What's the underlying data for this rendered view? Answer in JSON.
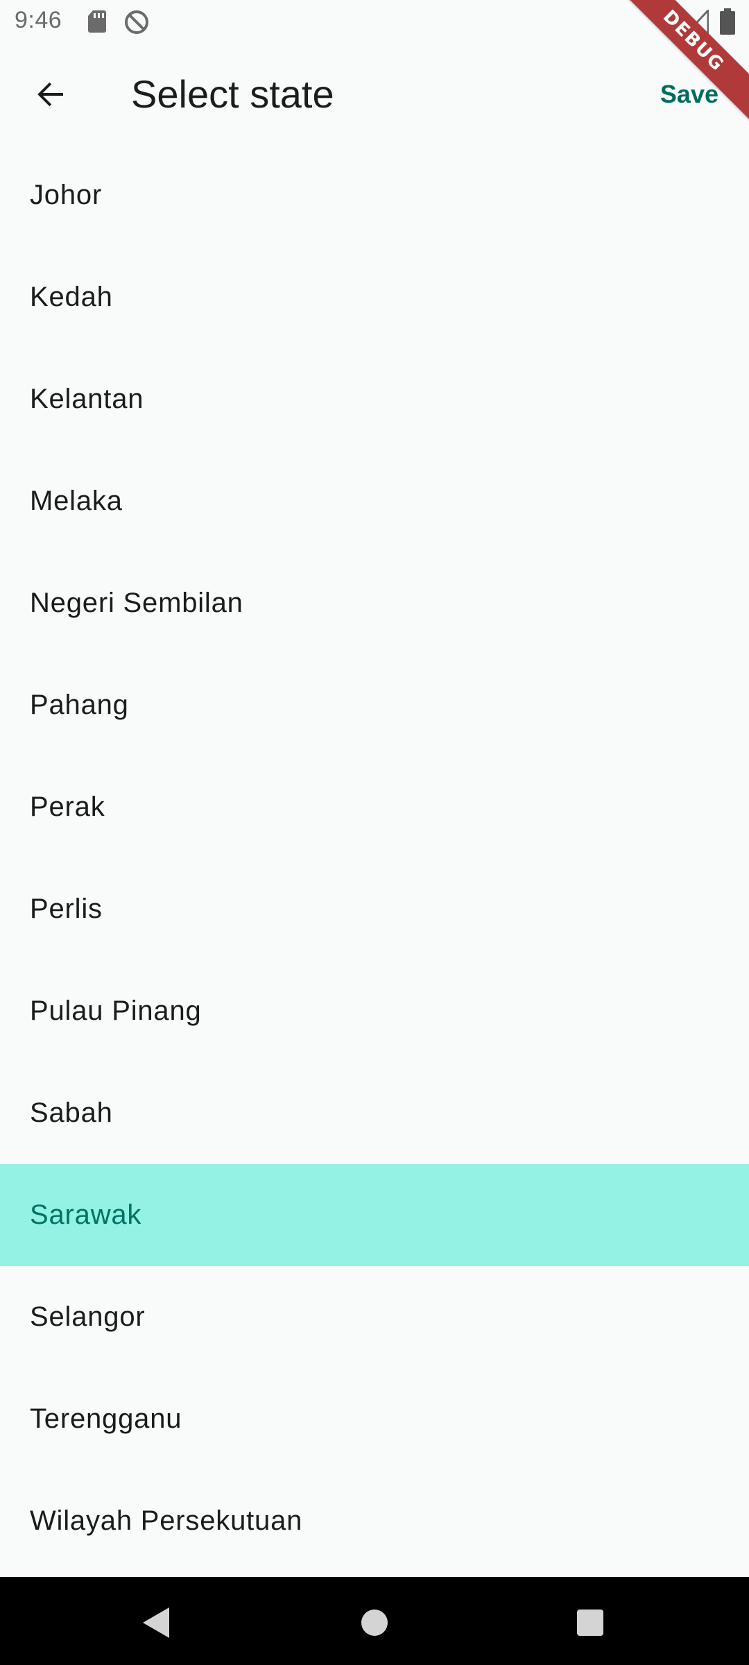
{
  "status_bar": {
    "time": "9:46",
    "icons": [
      "sd-card-icon",
      "do-not-disturb-icon",
      "wifi-icon",
      "signal-icon",
      "battery-icon"
    ]
  },
  "debug_banner": "DEBUG",
  "app_bar": {
    "back_icon": "arrow-back-icon",
    "title": "Select state",
    "save_label": "Save"
  },
  "states": [
    "Johor",
    "Kedah",
    "Kelantan",
    "Melaka",
    "Negeri Sembilan",
    "Pahang",
    "Perak",
    "Perlis",
    "Pulau Pinang",
    "Sabah",
    "Sarawak",
    "Selangor",
    "Terengganu",
    "Wilayah Persekutuan"
  ],
  "selected_state": "Sarawak",
  "colors": {
    "background": "#f9fbfb",
    "accent": "#006d5e",
    "selected_background": "#93f2e3",
    "selected_text": "#007263",
    "debug_banner": "#b03a3a"
  },
  "nav_bar": {
    "icons": [
      "nav-back-icon",
      "nav-home-icon",
      "nav-recents-icon"
    ]
  }
}
